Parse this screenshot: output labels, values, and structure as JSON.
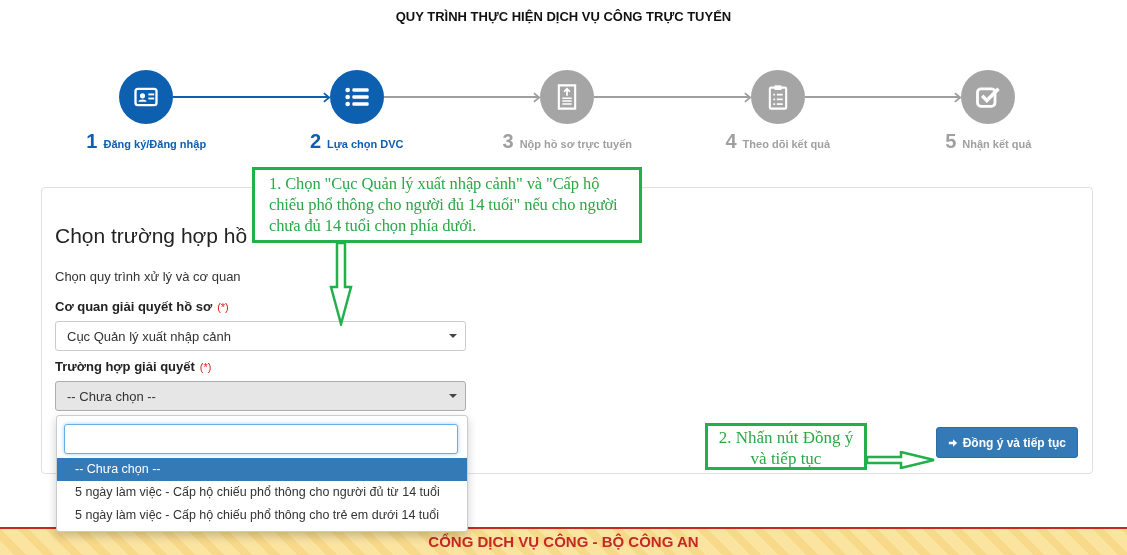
{
  "page_title": "QUY TRÌNH THỰC HIỆN DỊCH VỤ CÔNG TRỰC TUYẾN",
  "steps": [
    {
      "number": "1",
      "label": "Đăng ký/Đăng nhập",
      "active": true
    },
    {
      "number": "2",
      "label": "Lựa chọn DVC",
      "active": true
    },
    {
      "number": "3",
      "label": "Nộp hồ sơ trực tuyến",
      "active": false
    },
    {
      "number": "4",
      "label": "Theo dõi kết quả",
      "active": false
    },
    {
      "number": "5",
      "label": "Nhận kết quả",
      "active": false
    }
  ],
  "form": {
    "heading": "Chọn trường hợp hồ",
    "subtitle": "Chọn quy trình xử lý và cơ quan",
    "fields": [
      {
        "label": "Cơ quan giải quyết hồ sơ",
        "required_mark": "(*)",
        "value": "Cục Quản lý xuất nhập cảnh",
        "open": false
      },
      {
        "label": "Trường hợp giải quyết",
        "required_mark": "(*)",
        "value": "-- Chưa chọn --",
        "open": true
      }
    ],
    "dropdown_options": [
      {
        "label": "-- Chưa chọn --",
        "selected": true
      },
      {
        "label": "5 ngày làm việc - Cấp hộ chiếu phổ thông cho người đủ từ 14 tuổi",
        "selected": false
      },
      {
        "label": "5 ngày làm việc - Cấp hộ chiếu phổ thông cho trẻ em dưới 14 tuổi",
        "selected": false
      }
    ],
    "submit_button": "Đồng ý và tiếp tục"
  },
  "annotations": [
    {
      "text": "1. Chọn \"Cục Quản lý xuất nhập cảnh\" và \"Cấp hộ chiếu phổ thông cho người đủ 14 tuổi\" nếu cho người chưa đủ 14 tuổi chọn phía dưới."
    },
    {
      "text": "2. Nhấn nút Đồng ý và tiếp tục"
    }
  ],
  "footer": {
    "title": "CỔNG DỊCH VỤ CÔNG - BỘ CÔNG AN"
  }
}
